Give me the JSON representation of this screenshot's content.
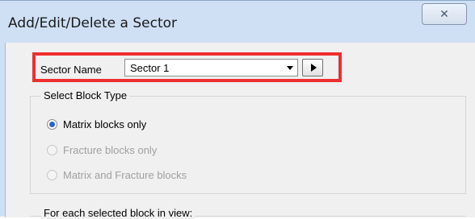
{
  "window": {
    "title": "Add/Edit/Delete a Sector",
    "close_glyph": "✕"
  },
  "sector": {
    "label": "Sector Name",
    "selected": "Sector 1"
  },
  "block_type": {
    "legend": "Select Block Type",
    "options": [
      {
        "label": "Matrix blocks only",
        "checked": true,
        "enabled": true
      },
      {
        "label": "Fracture blocks only",
        "checked": false,
        "enabled": false
      },
      {
        "label": "Matrix and Fracture blocks",
        "checked": false,
        "enabled": false
      }
    ]
  },
  "selection_group": {
    "legend": "For each selected block in view:"
  },
  "colors": {
    "highlight": "#ee2f2f",
    "title_bar": "#cfe0f5",
    "radio_selected": "#2a63c8"
  }
}
